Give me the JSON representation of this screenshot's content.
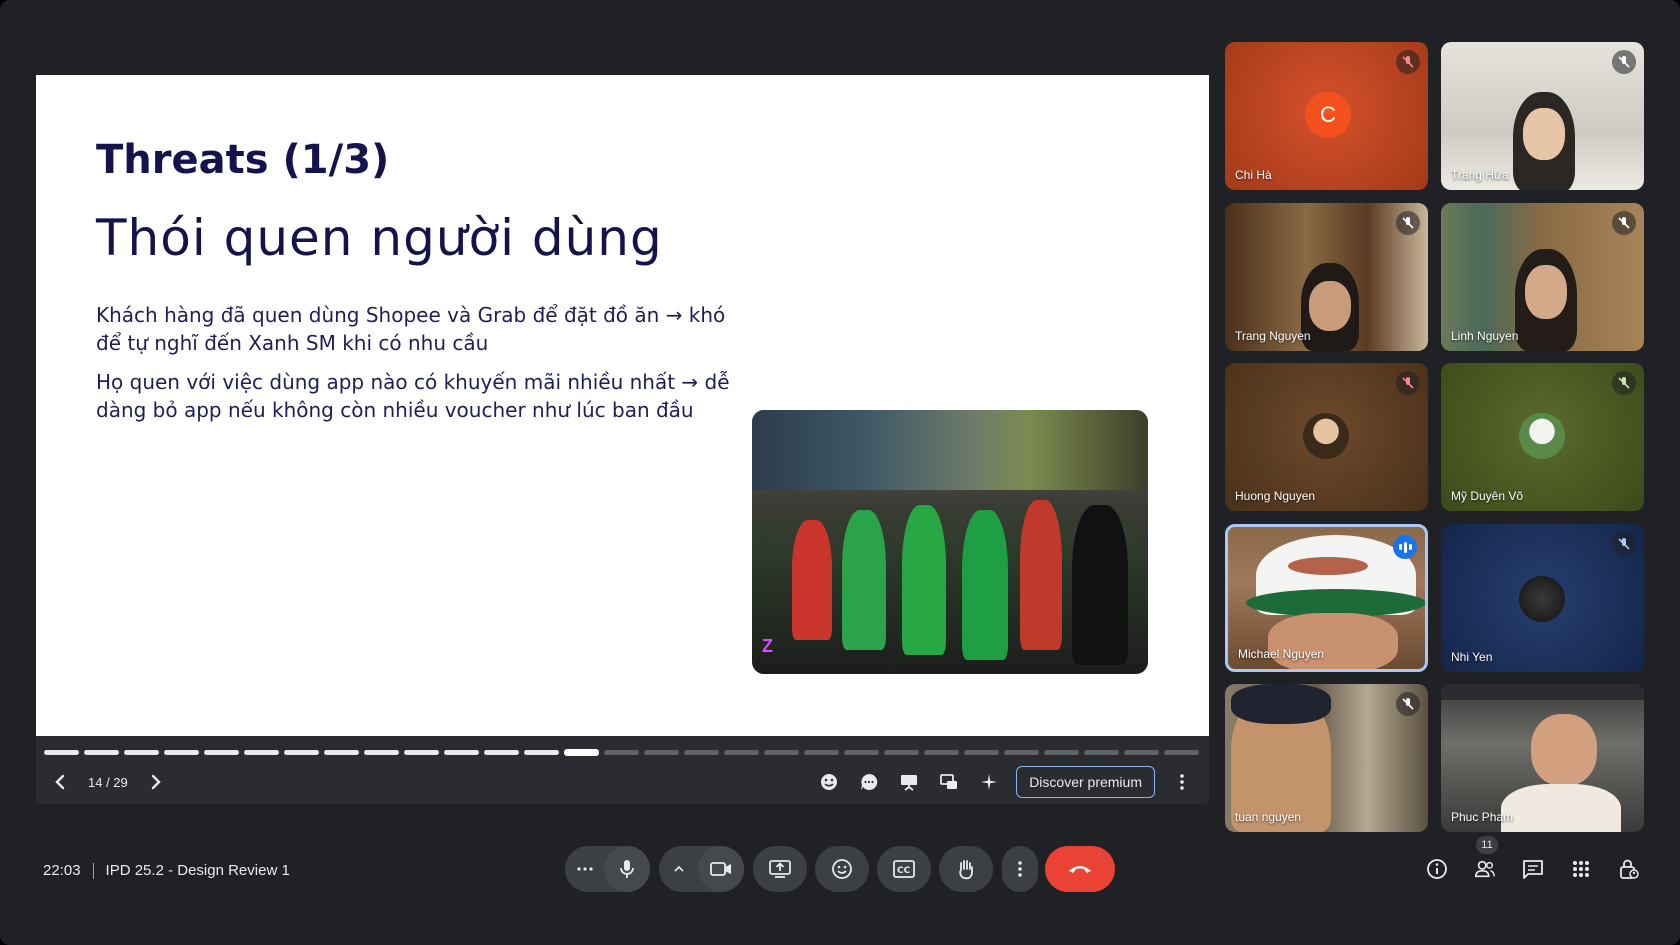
{
  "slide": {
    "title": "Threats (1/3)",
    "subtitle": "Thói quen người dùng",
    "paragraphs": [
      "Khách hàng đã quen dùng Shopee và Grab để đặt đồ ăn → khó để tự nghĩ đến Xanh SM khi có nhu cầu",
      "Họ quen với việc dùng app nào có khuyến mãi nhiều nhất → dễ dàng bỏ app nếu không còn nhiều voucher như lúc ban đầu"
    ]
  },
  "presenter_bar": {
    "page_label": "14 / 29",
    "current_page": 14,
    "total_pages": 29,
    "premium_label": "Discover premium"
  },
  "participants": [
    {
      "name": "Chi Hà",
      "muted": true,
      "avatar_letter": "C",
      "bg": "#c0401f"
    },
    {
      "name": "Trang Hứa",
      "muted": true,
      "bg": "#d9d7cf"
    },
    {
      "name": "Trang Nguyen",
      "muted": true,
      "bg": "#6b4a2c"
    },
    {
      "name": "Linh Nguyen",
      "muted": true,
      "bg": "#8a6b45"
    },
    {
      "name": "Huong Nguyen",
      "muted": true,
      "bg": "#5a3d22"
    },
    {
      "name": "Mỹ Duyên Võ",
      "muted": true,
      "bg": "#4a5a22"
    },
    {
      "name": "Michael Nguyen",
      "muted": false,
      "speaking": true,
      "bg": "#7a5a3c"
    },
    {
      "name": "Nhi Yen",
      "muted": true,
      "bg": "#1b2f57"
    },
    {
      "name": "tuan nguyen",
      "muted": true,
      "bg": "#7a6a58"
    },
    {
      "name": "Phuc Pham",
      "muted": false,
      "bg": "#4a4a4a"
    }
  ],
  "meeting": {
    "time": "22:03",
    "title": "IPD 25.2 - Design Review 1",
    "participant_count": "11"
  },
  "colors": {
    "accent": "#a8c7fa",
    "end_call": "#ea4335",
    "slide_text": "#14134b"
  }
}
